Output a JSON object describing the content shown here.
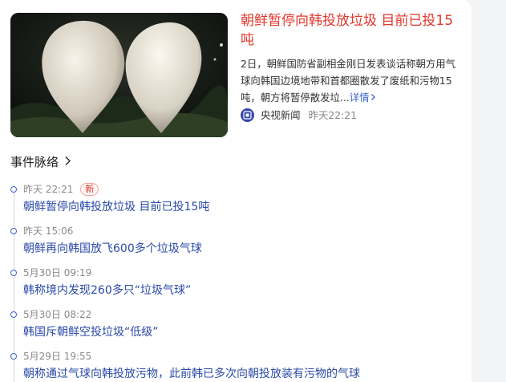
{
  "top_story": {
    "headline": "朝鲜暂停向韩投放垃圾 目前已投15吨",
    "summary": "2日，朝鲜国防省副相金刚日发表谈话称朝方用气球向韩国边境地带和首都圈散发了废纸和污物15吨，朝方将暂停散发垃...",
    "more_label": "详情",
    "source_name": "央视新闻",
    "source_time": "昨天22:21"
  },
  "timeline": {
    "title": "事件脉络",
    "items": [
      {
        "time": "昨天 22:21",
        "badge": "新",
        "title": "朝鲜暂停向韩投放垃圾 目前已投15吨"
      },
      {
        "time": "昨天 15:06",
        "title": "朝鲜再向韩国放飞600多个垃圾气球"
      },
      {
        "time": "5月30日 09:19",
        "title": "韩称境内发现260多只“垃圾气球”"
      },
      {
        "time": "5月30日 08:22",
        "title": "韩国斥朝鲜空投垃圾“低级”"
      },
      {
        "time": "5月29日 19:55",
        "title": "朝称通过气球向韩投放污物，此前韩已多次向朝投放装有污物的气球"
      }
    ]
  },
  "colors": {
    "headline": "#e4362b",
    "link": "#2b4aa8",
    "badge": "#e4362b",
    "timeline_dot": "#3a64ce"
  }
}
